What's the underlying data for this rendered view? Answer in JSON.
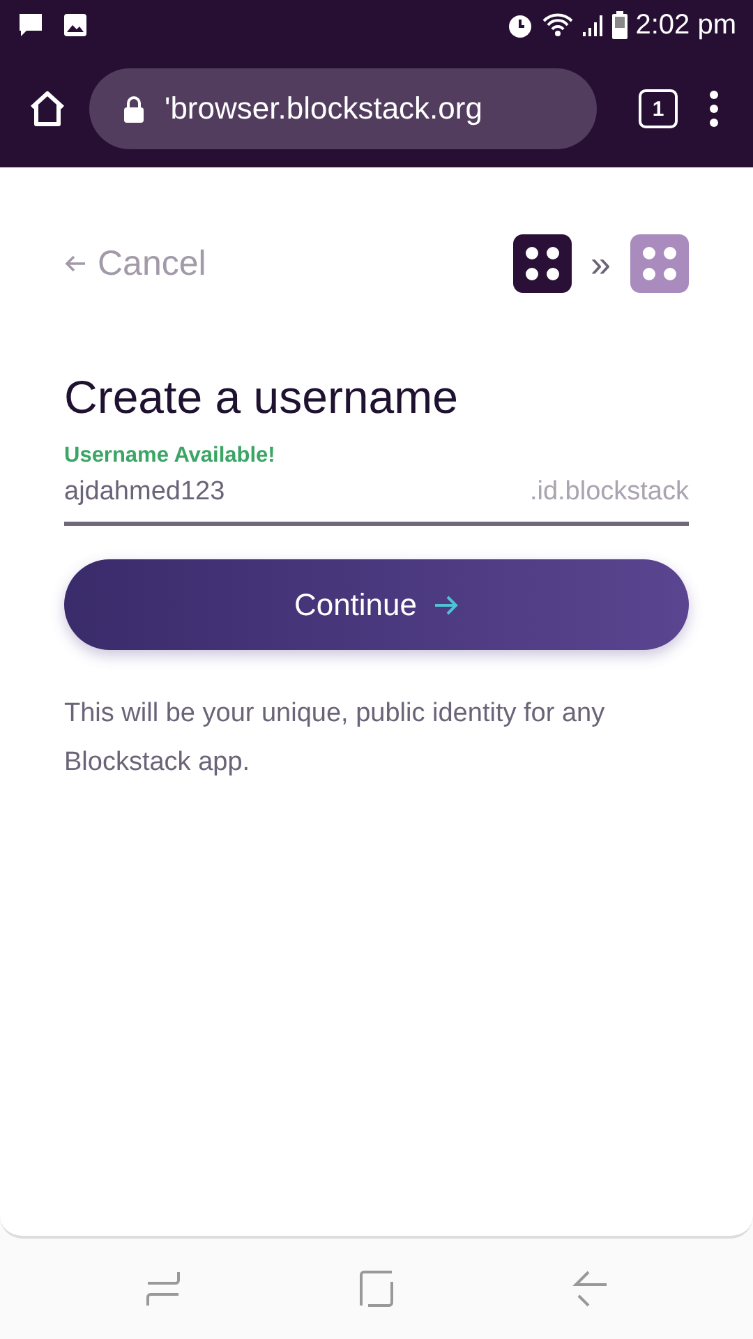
{
  "status_bar": {
    "time": "2:02 pm"
  },
  "browser": {
    "url": "'browser.blockstack.org",
    "tab_count": "1"
  },
  "header": {
    "cancel": "Cancel",
    "step_separator": "»"
  },
  "form": {
    "title": "Create a username",
    "status": "Username Available!",
    "value": "ajdahmed123",
    "suffix": ".id.blockstack",
    "button": "Continue",
    "note": "This will be your unique, public identity for any Blockstack app."
  }
}
